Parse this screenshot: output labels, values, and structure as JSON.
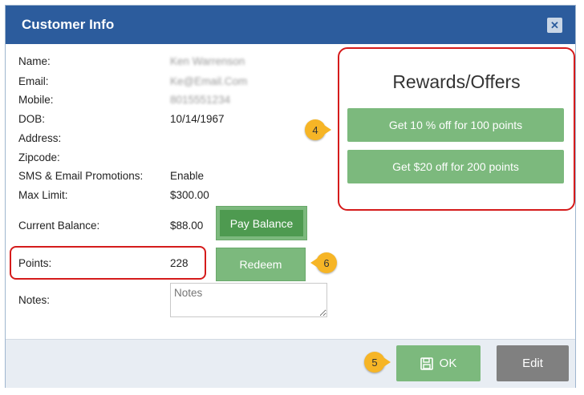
{
  "dialog": {
    "title": "Customer Info",
    "close_icon": "close-icon"
  },
  "customer": {
    "fields": [
      {
        "label": "Name:",
        "value": "Ken Warrenson",
        "blurred": true
      },
      {
        "label": "Email:",
        "value": "Ke@Email.Com",
        "blurred": true
      },
      {
        "label": "Mobile:",
        "value": "8015551234",
        "blurred": true
      },
      {
        "label": "DOB:",
        "value": "10/14/1967"
      },
      {
        "label": "Address:",
        "value": ""
      },
      {
        "label": "Zipcode:",
        "value": ""
      },
      {
        "label": "SMS & Email Promotions:",
        "value": "Enable"
      },
      {
        "label": "Max Limit:",
        "value": "$300.00"
      }
    ],
    "current_balance_label": "Current Balance:",
    "current_balance_value": "$88.00",
    "pay_balance_label": "Pay Balance",
    "points_label": "Points:",
    "points_value": "228",
    "redeem_label": "Redeem",
    "notes_label": "Notes:",
    "notes_placeholder": "Notes"
  },
  "rewards": {
    "title": "Rewards/Offers",
    "offers": [
      "Get 10 % off for 100 points",
      "Get $20 off for 200 points"
    ]
  },
  "footer": {
    "ok_label": "OK",
    "ok_icon": "save-icon",
    "edit_label": "Edit"
  },
  "markers": [
    "4",
    "5",
    "6"
  ],
  "colors": {
    "titlebar": "#2c5c9d",
    "green": "#7cb97d",
    "dark_green": "#4e9a50",
    "highlight": "#d51b1b",
    "marker": "#f6b526",
    "edit": "#808080"
  }
}
